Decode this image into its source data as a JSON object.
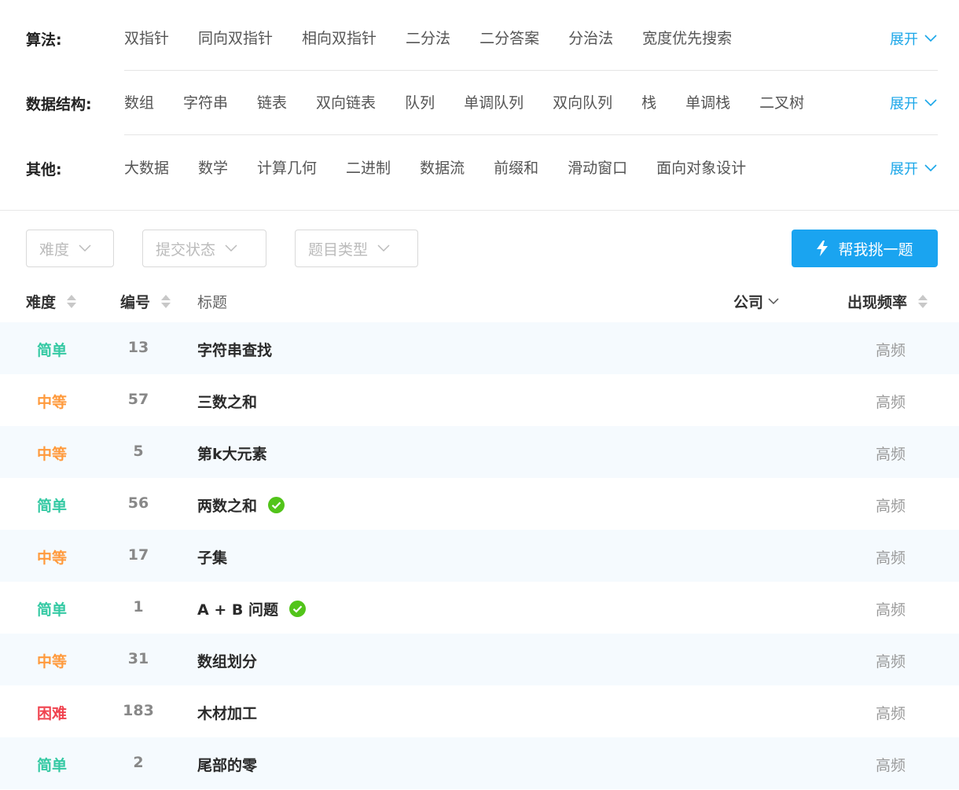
{
  "filters": [
    {
      "label": "算法:",
      "tags": [
        "双指针",
        "同向双指针",
        "相向双指针",
        "二分法",
        "二分答案",
        "分治法",
        "宽度优先搜索"
      ],
      "expand": "展开"
    },
    {
      "label": "数据结构:",
      "tags": [
        "数组",
        "字符串",
        "链表",
        "双向链表",
        "队列",
        "单调队列",
        "双向队列",
        "栈",
        "单调栈",
        "二叉树"
      ],
      "expand": "展开"
    },
    {
      "label": "其他:",
      "tags": [
        "大数据",
        "数学",
        "计算几何",
        "二进制",
        "数据流",
        "前缀和",
        "滑动窗口",
        "面向对象设计"
      ],
      "expand": "展开"
    }
  ],
  "toolbar": {
    "difficulty": "难度",
    "status": "提交状态",
    "type": "题目类型",
    "pick_button": "帮我挑一题"
  },
  "table": {
    "headers": {
      "difficulty": "难度",
      "number": "编号",
      "title": "标题",
      "company": "公司",
      "frequency": "出现频率"
    },
    "rows": [
      {
        "difficulty": "简单",
        "number": "13",
        "title": "字符串查找",
        "solved": false,
        "frequency": "高频"
      },
      {
        "difficulty": "中等",
        "number": "57",
        "title": "三数之和",
        "solved": false,
        "frequency": "高频"
      },
      {
        "difficulty": "中等",
        "number": "5",
        "title": "第k大元素",
        "solved": false,
        "frequency": "高频"
      },
      {
        "difficulty": "简单",
        "number": "56",
        "title": "两数之和",
        "solved": true,
        "frequency": "高频"
      },
      {
        "difficulty": "中等",
        "number": "17",
        "title": "子集",
        "solved": false,
        "frequency": "高频"
      },
      {
        "difficulty": "简单",
        "number": "1",
        "title": "A + B 问题",
        "solved": true,
        "frequency": "高频"
      },
      {
        "difficulty": "中等",
        "number": "31",
        "title": "数组划分",
        "solved": false,
        "frequency": "高频"
      },
      {
        "difficulty": "困难",
        "number": "183",
        "title": "木材加工",
        "solved": false,
        "frequency": "高频"
      },
      {
        "difficulty": "简单",
        "number": "2",
        "title": "尾部的零",
        "solved": false,
        "frequency": "高频"
      }
    ]
  },
  "colors": {
    "easy": "#34c9a3",
    "medium": "#ff9a3c",
    "hard": "#f0434f",
    "accent": "#1aa4f0",
    "solved": "#52c41a"
  },
  "icons": {
    "expand": "chevron-down-icon",
    "dropdown": "chevron-down-icon",
    "pick_button": "lightning-icon",
    "sort": "sort-icon",
    "solved": "check-circle-icon"
  }
}
